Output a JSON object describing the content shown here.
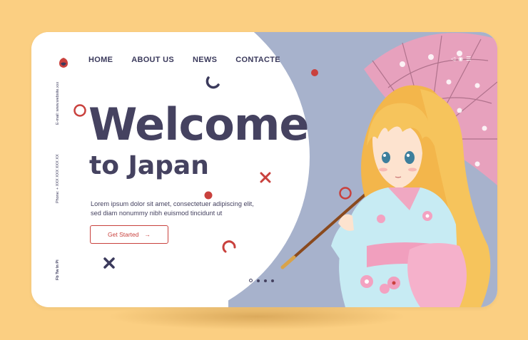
{
  "nav": {
    "items": [
      {
        "label": "HOME"
      },
      {
        "label": "ABOUT US"
      },
      {
        "label": "NEWS"
      },
      {
        "label": "CONTACTE"
      }
    ]
  },
  "hero": {
    "title_line1": "Welcome",
    "title_line2": "to Japan",
    "description": "Lorem ipsum dolor sit amet, consectetuer adipiscing elit, sed diam nonummy nibh euismod tincidunt ut",
    "cta_label": "Get Started",
    "cta_arrow": "→"
  },
  "sidebar": {
    "phone": "Phone: + XXX XXX XXX XX",
    "email": "E-mail: www.website.xxx",
    "follow": "Fb Tw In Pi"
  },
  "carousel": {
    "count": 4,
    "active_index": 0
  },
  "colors": {
    "accent": "#c9413d",
    "text": "#454260",
    "page_bg": "#fbcf82",
    "blue_panel": "#a7b2cc",
    "umbrella": "#e7a1bd",
    "kimono": "#c7ebf3",
    "hair": "#f6c45c"
  },
  "icons": [
    "logo-icon",
    "arrow-right-icon",
    "share-icon",
    "user-icon",
    "menu-icon"
  ]
}
